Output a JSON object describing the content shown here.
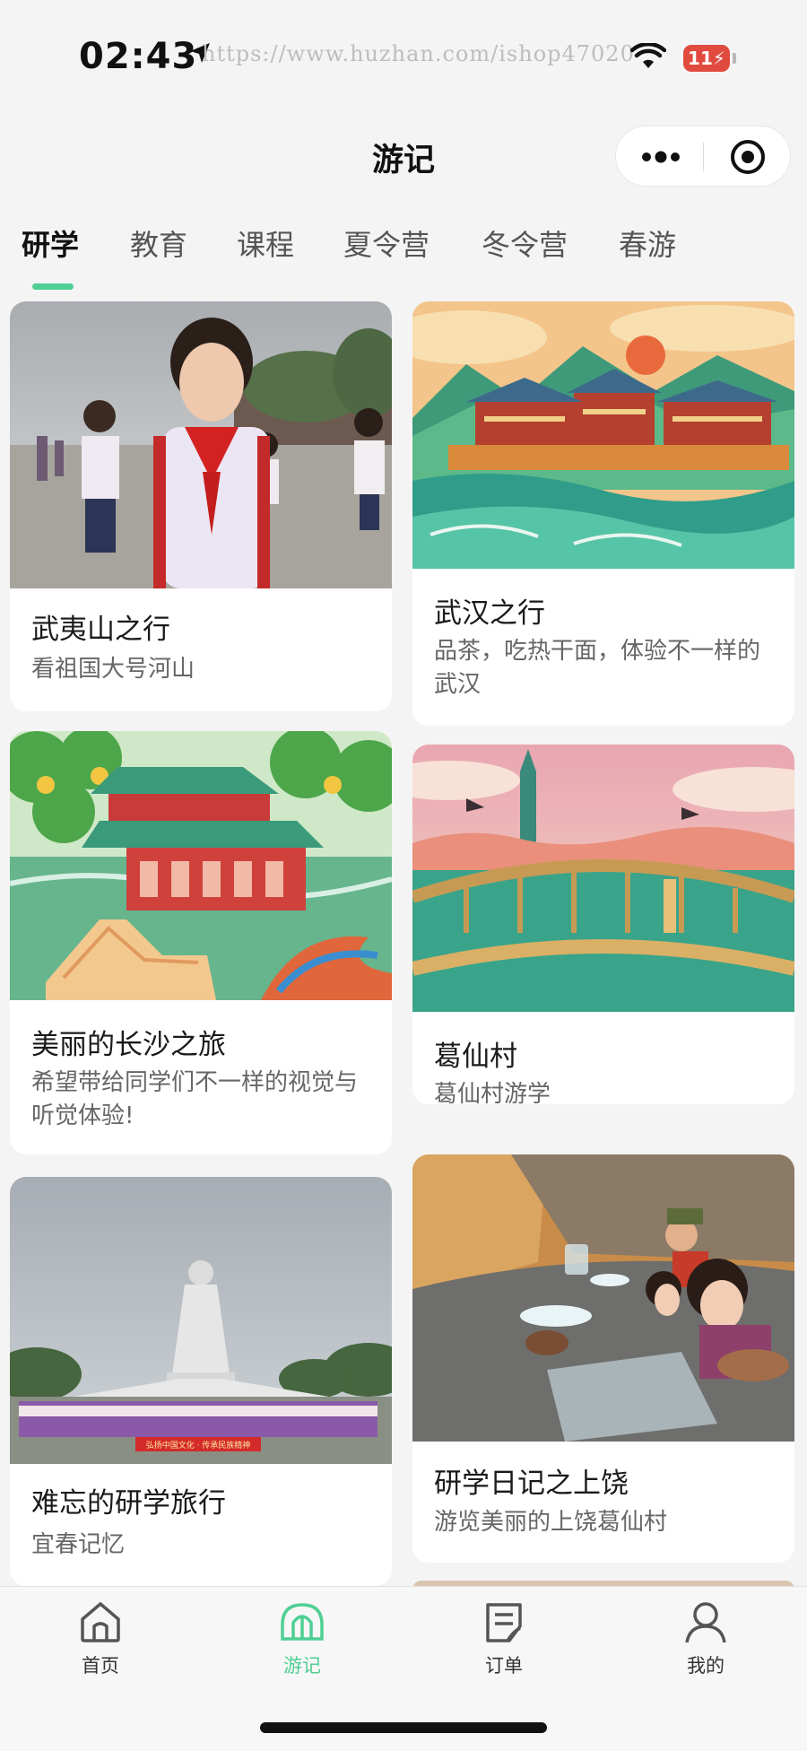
{
  "status_bar": {
    "time": "02:43",
    "watermark": "https://www.huzhan.com/ishop47020",
    "battery": "11"
  },
  "nav": {
    "title": "游记"
  },
  "tabs": [
    {
      "label": "研学",
      "active": true
    },
    {
      "label": "教育"
    },
    {
      "label": "课程"
    },
    {
      "label": "夏令营"
    },
    {
      "label": "冬令营"
    },
    {
      "label": "春游"
    }
  ],
  "cards": [
    {
      "title": "武夷山之行",
      "desc": "看祖国大号河山"
    },
    {
      "title": "武汉之行",
      "desc": "品茶，吃热干面，体验不一样的武汉"
    },
    {
      "title": "美丽的长沙之旅",
      "desc": "希望带给同学们不一样的视觉与听觉体验!"
    },
    {
      "title": "葛仙村",
      "desc": "葛仙村游学"
    },
    {
      "title": "难忘的研学旅行",
      "desc": "宜春记忆"
    },
    {
      "title": "研学日记之上饶",
      "desc": "游览美丽的上饶葛仙村"
    }
  ],
  "photo_banner": "弘扬中国文化 · 传承民族精神",
  "tabbar": [
    {
      "label": "首页",
      "icon": "home-icon"
    },
    {
      "label": "游记",
      "icon": "travel-notes-icon",
      "active": true
    },
    {
      "label": "订单",
      "icon": "order-icon"
    },
    {
      "label": "我的",
      "icon": "profile-icon"
    }
  ],
  "colors": {
    "accent": "#4fcf94",
    "background": "#f4f4f4",
    "card": "#ffffff"
  }
}
